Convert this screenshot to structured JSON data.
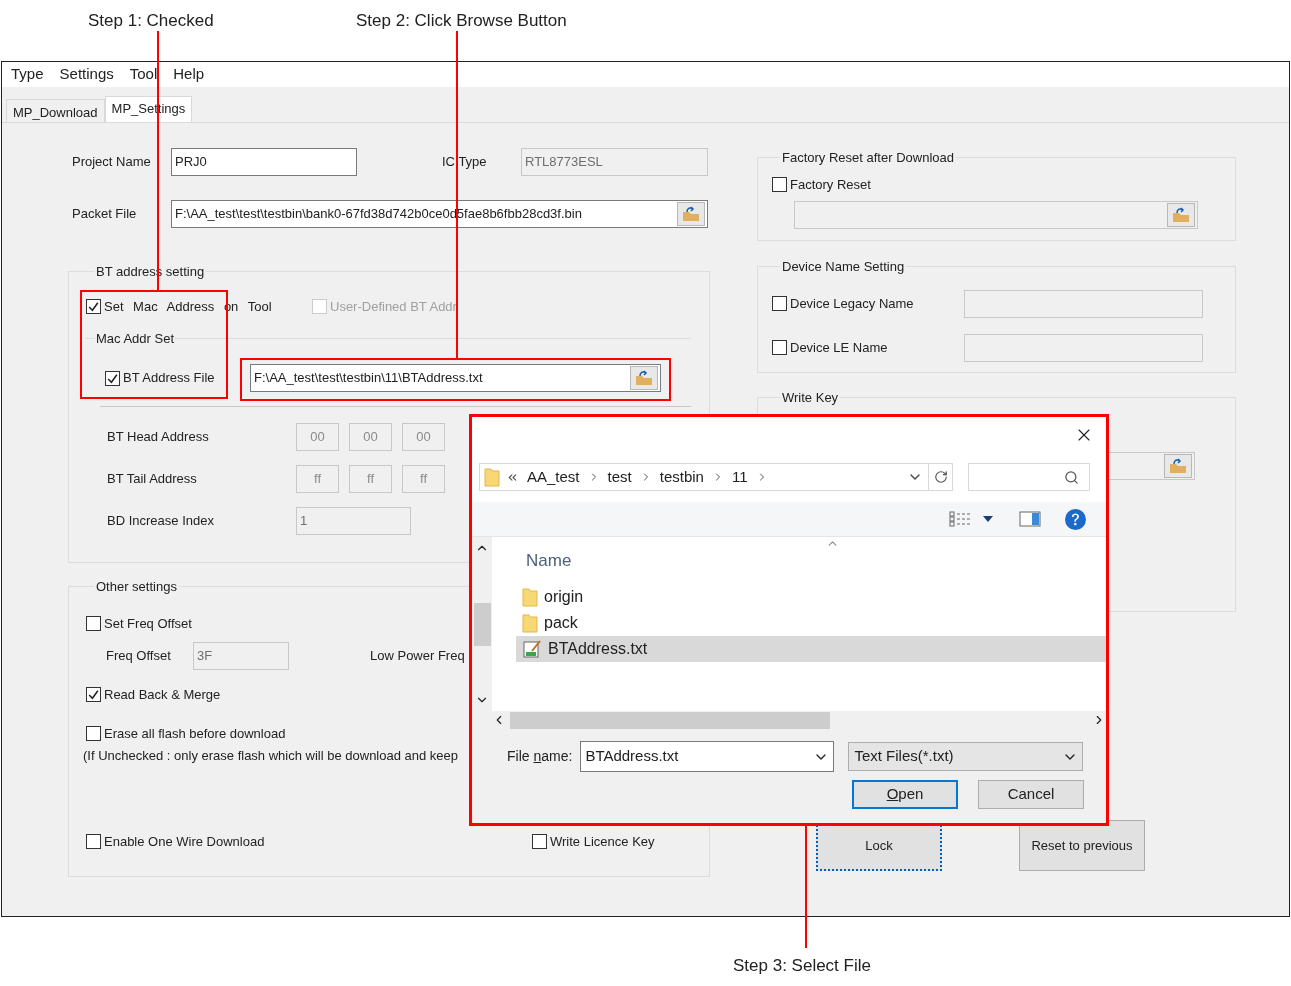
{
  "annotations": [
    {
      "text": "Step 1: Checked"
    },
    {
      "text": "Step 2: Click Browse Button"
    },
    {
      "text": "Step 3: Select File"
    }
  ],
  "menu": [
    "Type",
    "Settings",
    "Tool",
    "Help"
  ],
  "tabs": [
    {
      "label": "MP_Download",
      "selected": false
    },
    {
      "label": "MP_Settings",
      "selected": true
    }
  ],
  "project": {
    "project_name": {
      "label": "Project Name",
      "value": "PRJ0",
      "disabled": false
    },
    "ic_type": {
      "label": "IC Type",
      "value": "RTL8773ESL",
      "disabled": true
    },
    "packet_file": {
      "label": "Packet File",
      "value": "F:\\AA_test\\test\\testbin\\bank0-67fd38d742b0ce0d5fae8b6fbb28cd3f.bin",
      "disabled": false
    }
  },
  "bt_address_setting": {
    "title": "BT address setting",
    "set_mac": {
      "label": "Set Mac Address on Tool",
      "checked": true,
      "disabled": false
    },
    "user_defined": {
      "label": "User-Defined BT Addr",
      "checked": false,
      "disabled": true
    },
    "mac_addr_set": {
      "title": "Mac Addr Set",
      "bt_address_file": {
        "label": "BT Address File",
        "checked": true,
        "disabled": false,
        "value": "F:\\AA_test\\test\\testbin\\11\\BTAddress.txt"
      }
    },
    "head": {
      "label": "BT Head Address",
      "values": [
        "00",
        "00",
        "00"
      ]
    },
    "tail": {
      "label": "BT Tail Address",
      "values": [
        "ff",
        "ff",
        "ff"
      ]
    },
    "increase": {
      "label": "BD Increase Index",
      "value": "1",
      "disabled": true
    }
  },
  "other_settings": {
    "title": "Other settings",
    "set_freq_offset": {
      "label": "Set Freq Offset",
      "checked": false,
      "disabled": false
    },
    "freq_offset": {
      "label": "Freq Offset",
      "value": "3F",
      "disabled": true
    },
    "low_power_freq": {
      "label": "Low Power Freq"
    },
    "read_back": {
      "label": "Read Back & Merge",
      "checked": true,
      "disabled": false
    },
    "erase_all": {
      "label": "Erase all flash before download",
      "checked": false,
      "disabled": false
    },
    "erase_note": "(If Unchecked : only erase flash which will be download and keep",
    "one_wire": {
      "label": "Enable One Wire Download",
      "checked": false,
      "disabled": false
    },
    "licence": {
      "label": "Write Licence Key",
      "checked": false,
      "disabled": false
    }
  },
  "factory_reset": {
    "title": "Factory Reset after Download",
    "checkbox": {
      "label": "Factory Reset",
      "checked": false,
      "disabled": false
    }
  },
  "device_name": {
    "title": "Device Name Setting",
    "legacy": {
      "label": "Device Legacy Name",
      "checked": false,
      "disabled": false
    },
    "le": {
      "label": "Device LE Name",
      "checked": false,
      "disabled": false
    }
  },
  "write_key": {
    "title": "Write Key"
  },
  "buttons": [
    {
      "label": "Lock",
      "focused": true
    },
    {
      "label": "Reset to previous",
      "focused": false
    }
  ],
  "dialog": {
    "breadcrumb": [
      "AA_test",
      "test",
      "testbin",
      "11"
    ],
    "column": "Name",
    "files": [
      {
        "name": "origin",
        "kind": "folder",
        "selected": false
      },
      {
        "name": "pack",
        "kind": "folder",
        "selected": false
      },
      {
        "name": "BTAddress.txt",
        "kind": "text",
        "selected": true
      }
    ],
    "file_name": {
      "label": "File name:",
      "value": "BTAddress.txt"
    },
    "filter": "Text Files(*.txt)",
    "buttons": [
      {
        "label": "Open",
        "default": true
      },
      {
        "label": "Cancel",
        "default": false
      }
    ]
  }
}
